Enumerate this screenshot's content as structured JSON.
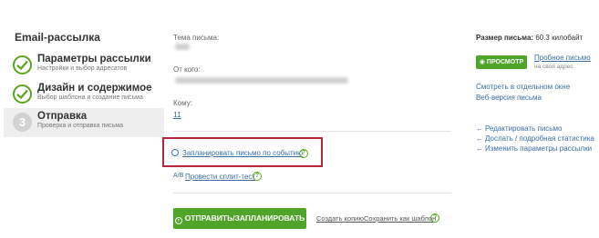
{
  "sidebar": {
    "title": "Email-рассылка",
    "steps": [
      {
        "label": "Параметры рассылки",
        "sub": "Настройки и выбор адресатов",
        "state": "done"
      },
      {
        "label": "Дизайн и содержимое",
        "sub": "Выбор шаблона и создание письма",
        "state": "done"
      },
      {
        "label": "Отправка",
        "sub": "Проверка и отправка письма",
        "state": "current",
        "number": "3"
      }
    ]
  },
  "main": {
    "subject_label": "Тема письма:",
    "from_label": "От кого:",
    "to_label": "Кому:",
    "to_value": "11",
    "schedule_link": "Запланировать письмо по событию",
    "split_icon": "A/B",
    "split_link": "Провести сплит-тест",
    "help_glyph": "?",
    "send_button": "ОТПРАВИТЬ/ЗАПЛАНИРОВАТЬ",
    "copy_link": "Создать копию",
    "save_template_link": "Сохранить как шаблон"
  },
  "right": {
    "size_label": "Размер письма:",
    "size_value": "60.3 килобайт",
    "preview_button": "ПРОСМОТР",
    "test_link": "Пробное письмо",
    "test_sub": "на свой адрес",
    "open_window": "Смотреть в отдельном окне",
    "web_version": "Веб-версия письма",
    "actions": [
      "Редактировать письмо",
      "Дослать / подробная статистика",
      "Изменить параметры рассылки"
    ]
  },
  "colors": {
    "accent_green": "#4ea52a",
    "link_blue": "#3a6ea5",
    "highlight_red": "#b6283a"
  }
}
